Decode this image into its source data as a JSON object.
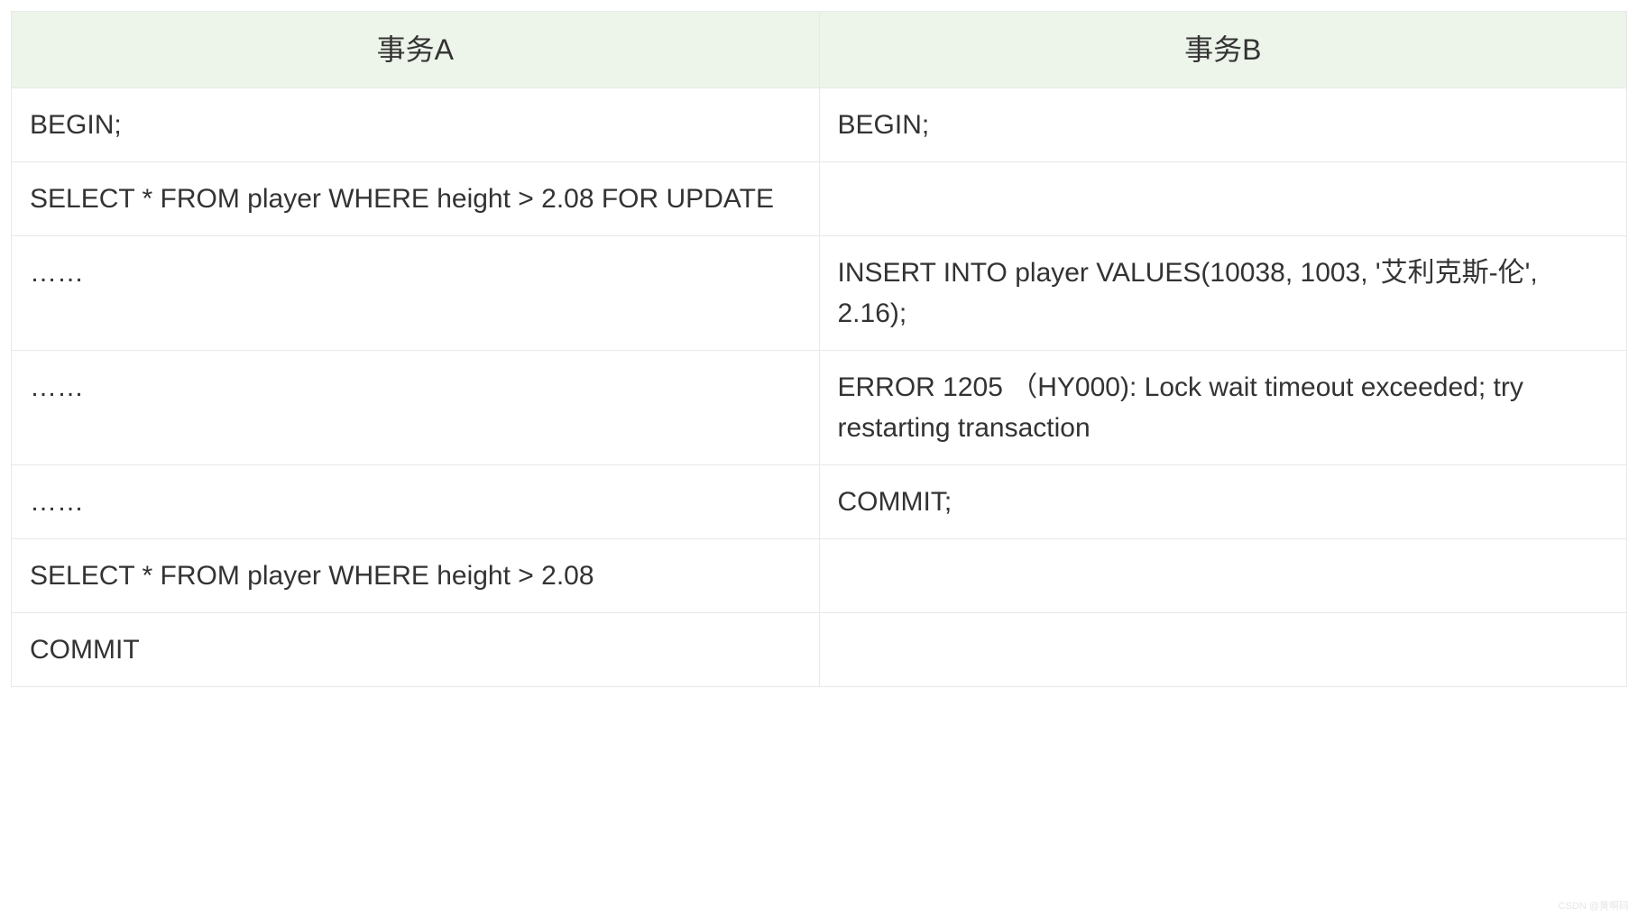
{
  "table": {
    "headers": [
      "事务A",
      "事务B"
    ],
    "rows": [
      {
        "a": "BEGIN;",
        "b": "BEGIN;"
      },
      {
        "a": "SELECT * FROM   player WHERE height > 2.08 FOR UPDATE",
        "b": ""
      },
      {
        "a": "……",
        "b": "INSERT INTO   player VALUES(10038, 1003, '艾利克斯-伦', 2.16);"
      },
      {
        "a": "……",
        "b": "ERROR 1205 （HY000): Lock wait timeout exceeded; try restarting transaction"
      },
      {
        "a": "……",
        "b": "COMMIT;"
      },
      {
        "a": "SELECT * FROM   player WHERE height > 2.08",
        "b": ""
      },
      {
        "a": "COMMIT",
        "b": ""
      }
    ]
  },
  "watermark": "CSDN @黄啊码"
}
